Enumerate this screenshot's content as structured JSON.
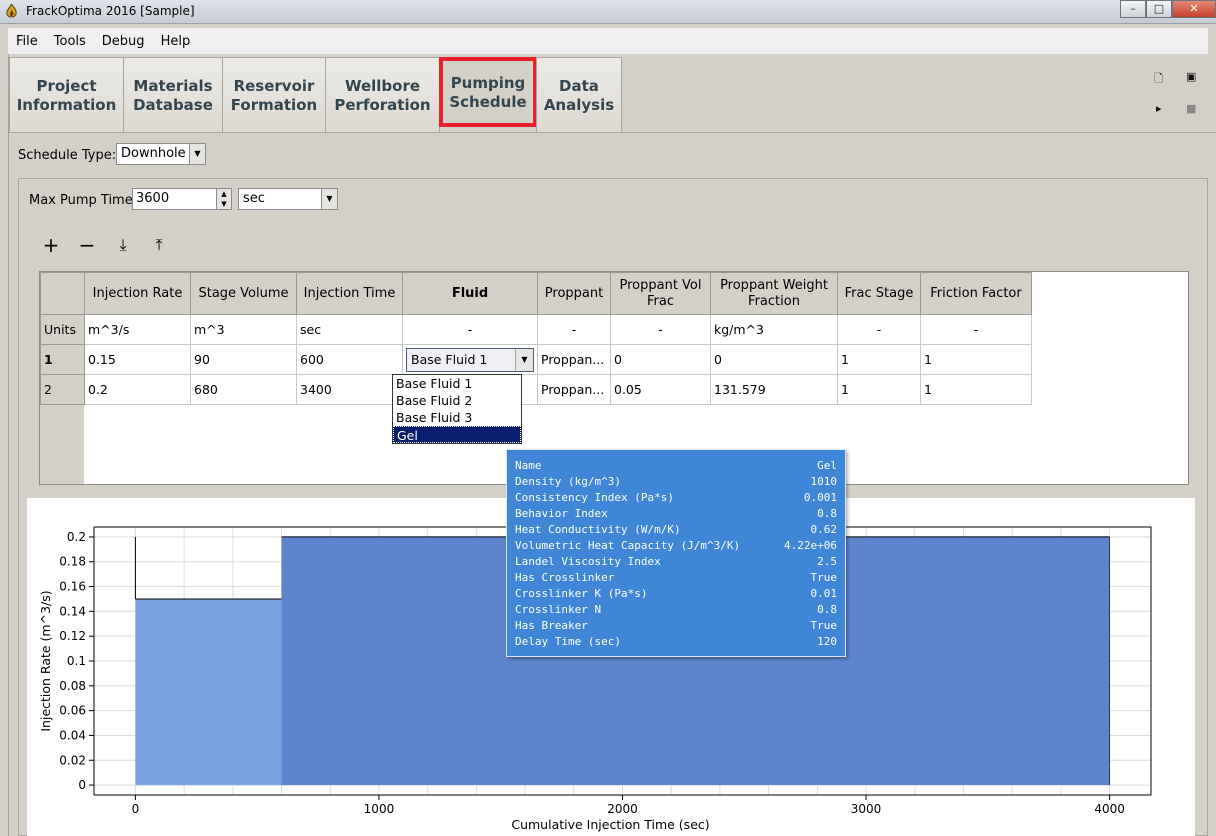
{
  "window": {
    "title": "FrackOptima 2016 [Sample]"
  },
  "menu": [
    "File",
    "Tools",
    "Debug",
    "Help"
  ],
  "tabs": [
    {
      "line1": "Project",
      "line2": "Information"
    },
    {
      "line1": "Materials",
      "line2": "Database"
    },
    {
      "line1": "Reservoir",
      "line2": "Formation"
    },
    {
      "line1": "Wellbore",
      "line2": "Perforation"
    },
    {
      "line1": "Pumping",
      "line2": "Schedule"
    },
    {
      "line1": "Data",
      "line2": "Analysis"
    }
  ],
  "schedule": {
    "type_label": "Schedule Type:",
    "type_value": "Downhole"
  },
  "pump": {
    "label": "Max Pump Time:",
    "value": "3600",
    "unit": "sec"
  },
  "table": {
    "headers": [
      "Injection Rate",
      "Stage Volume",
      "Injection Time",
      "Fluid",
      "Proppant",
      "Proppant Vol Frac",
      "Proppant Weight Fraction",
      "Frac Stage",
      "Friction Factor"
    ],
    "units_label": "Units",
    "units": [
      "m^3/s",
      "m^3",
      "sec",
      "-",
      "-",
      "-",
      "kg/m^3",
      "-",
      "-"
    ],
    "rows": [
      {
        "id": "1",
        "rate": "0.15",
        "volume": "90",
        "time": "600",
        "fluid": "Base Fluid 1",
        "proppant": "Proppan...",
        "vol_frac": "0",
        "weight": "0",
        "stage": "1",
        "friction": "1"
      },
      {
        "id": "2",
        "rate": "0.2",
        "volume": "680",
        "time": "3400",
        "fluid": "",
        "proppant": "Proppan...",
        "vol_frac": "0.05",
        "weight": "131.579",
        "stage": "1",
        "friction": "1"
      }
    ]
  },
  "dropdown": {
    "options": [
      "Base Fluid 1",
      "Base Fluid 2",
      "Base Fluid 3",
      "Gel"
    ],
    "selected": "Gel"
  },
  "tooltip": [
    {
      "k": "Name",
      "v": "Gel"
    },
    {
      "k": "Density (kg/m^3)",
      "v": "1010"
    },
    {
      "k": "Consistency Index (Pa*s)",
      "v": "0.001"
    },
    {
      "k": "Behavior Index",
      "v": "0.8"
    },
    {
      "k": "Heat Conductivity (W/m/K)",
      "v": "0.62"
    },
    {
      "k": "Volumetric Heat Capacity (J/m^3/K)",
      "v": "4.22e+06"
    },
    {
      "k": "Landel Viscosity Index",
      "v": "2.5"
    },
    {
      "k": "Has Crosslinker",
      "v": "True"
    },
    {
      "k": "Crosslinker K (Pa*s)",
      "v": "0.01"
    },
    {
      "k": "Crosslinker N",
      "v": "0.8"
    },
    {
      "k": "Has Breaker",
      "v": "True"
    },
    {
      "k": "Delay Time (sec)",
      "v": "120"
    }
  ],
  "chart_data": {
    "type": "area",
    "xlabel": "Cumulative Injection Time (sec)",
    "ylabel": "Injection Rate (m^3/s)",
    "xlim": [
      -170,
      4170
    ],
    "ylim": [
      -0.008,
      0.208
    ],
    "xticks": [
      0,
      1000,
      2000,
      3000,
      4000
    ],
    "yticks": [
      0,
      0.02,
      0.04,
      0.06,
      0.08,
      0.1,
      0.12,
      0.14,
      0.16,
      0.18,
      0.2
    ],
    "grid": true,
    "stages": [
      {
        "x0": 0,
        "x1": 600,
        "rate": 0.15,
        "color": "#7aa2e2"
      },
      {
        "x0": 600,
        "x1": 4000,
        "rate": 0.2,
        "color": "#5d84cc"
      }
    ]
  },
  "colors": {
    "tab_highlight": "#e8202a",
    "tooltip_bg": "#3f87d6",
    "selection": "#0a1e6e"
  }
}
